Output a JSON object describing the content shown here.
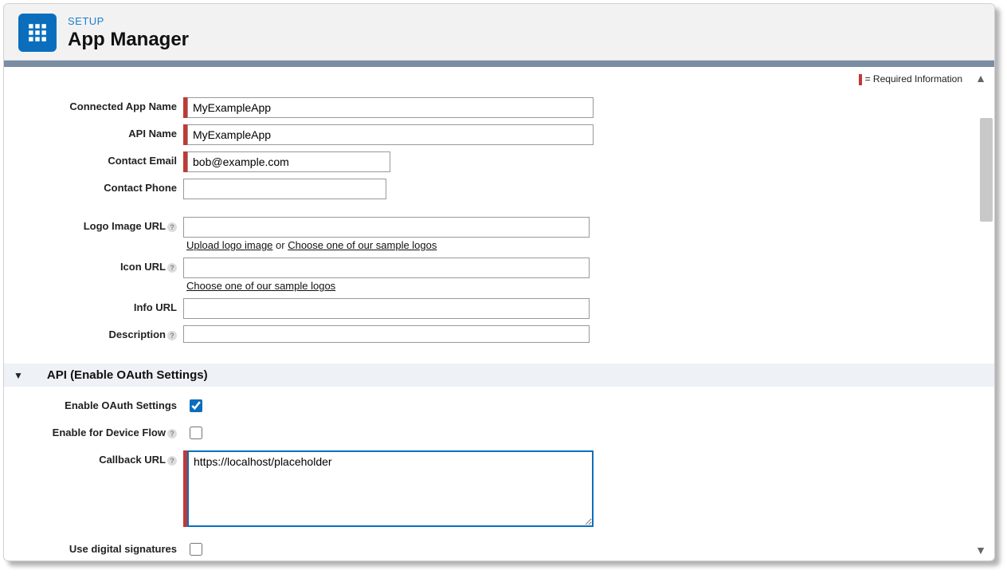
{
  "header": {
    "setup_label": "SETUP",
    "title": "App Manager"
  },
  "required_info_label": "= Required Information",
  "fields": {
    "connected_app_name": {
      "label": "Connected App Name",
      "value": "MyExampleApp",
      "required": true
    },
    "api_name": {
      "label": "API Name",
      "value": "MyExampleApp",
      "required": true
    },
    "contact_email": {
      "label": "Contact Email",
      "value": "bob@example.com",
      "required": true
    },
    "contact_phone": {
      "label": "Contact Phone",
      "value": ""
    },
    "logo_image_url": {
      "label": "Logo Image URL",
      "value": "",
      "helper_upload": "Upload logo image",
      "helper_or": " or ",
      "helper_choose": "Choose one of our sample logos"
    },
    "icon_url": {
      "label": "Icon URL",
      "value": "",
      "helper_choose": "Choose one of our sample logos"
    },
    "info_url": {
      "label": "Info URL",
      "value": ""
    },
    "description": {
      "label": "Description",
      "value": ""
    }
  },
  "section_oauth": {
    "title": "API (Enable OAuth Settings)",
    "enable_oauth": {
      "label": "Enable OAuth Settings",
      "checked": true
    },
    "enable_device_flow": {
      "label": "Enable for Device Flow",
      "checked": false
    },
    "callback_url": {
      "label": "Callback URL",
      "value": "https://localhost/placeholder",
      "required": true
    },
    "use_digital_signatures": {
      "label": "Use digital signatures",
      "checked": false
    }
  }
}
